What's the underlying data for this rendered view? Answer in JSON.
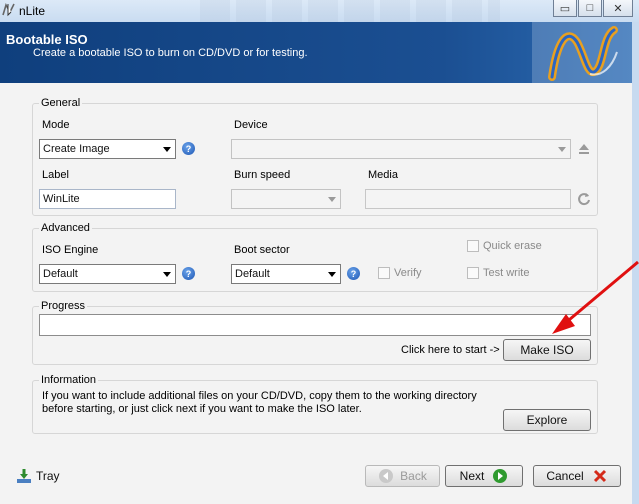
{
  "window": {
    "title": "nLite",
    "minimize_glyph": "▭",
    "maximize_glyph": "□",
    "close_glyph": "✕"
  },
  "header": {
    "title": "Bootable ISO",
    "subtitle": "Create a bootable ISO to burn on CD/DVD or for testing."
  },
  "general": {
    "group_label": "General",
    "mode_label": "Mode",
    "mode_value": "Create Image",
    "device_label": "Device",
    "device_value": "",
    "label_label": "Label",
    "label_value": "WinLite",
    "burn_speed_label": "Burn speed",
    "burn_speed_value": "",
    "media_label": "Media",
    "media_value": ""
  },
  "advanced": {
    "group_label": "Advanced",
    "iso_engine_label": "ISO Engine",
    "iso_engine_value": "Default",
    "boot_sector_label": "Boot sector",
    "boot_sector_value": "Default",
    "quick_erase_label": "Quick erase",
    "verify_label": "Verify",
    "test_write_label": "Test write"
  },
  "progress": {
    "group_label": "Progress",
    "value": 0,
    "start_hint": "Click here to start ->",
    "make_iso_label": "Make ISO"
  },
  "information": {
    "group_label": "Information",
    "text": "If you want to include additional files on your CD/DVD, copy them to the working directory before starting, or just click next if you want to make the ISO later.",
    "explore_label": "Explore"
  },
  "footer": {
    "tray_label": "Tray",
    "back_label": "Back",
    "next_label": "Next",
    "cancel_label": "Cancel"
  },
  "colors": {
    "header_bg": "#1b4f92",
    "annotation_arrow": "#e01010"
  },
  "icons": [
    "nlite-logo",
    "help-icon",
    "eject-icon",
    "refresh-icon",
    "tray-icon",
    "back-icon",
    "next-icon",
    "cancel-icon"
  ]
}
